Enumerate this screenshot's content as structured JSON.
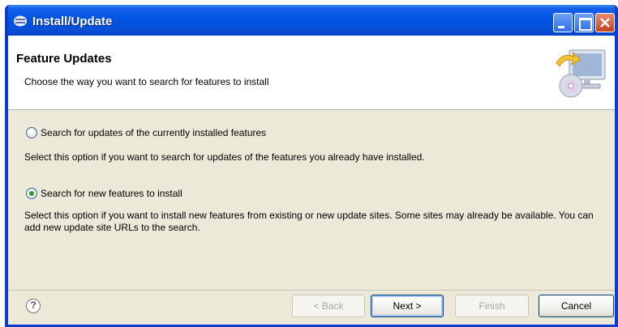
{
  "window": {
    "title": "Install/Update"
  },
  "banner": {
    "title": "Feature Updates",
    "description": "Choose the way you want to search for features to install"
  },
  "options": [
    {
      "label": "Search for updates of the currently installed features",
      "description": "Select this option if you want to search for updates of the features you already have installed.",
      "selected": false
    },
    {
      "label": "Search for new features to install",
      "description": "Select this option if you want to install new features from existing or new update sites. Some sites may already be available. You can add new update site URLs to the search.",
      "selected": true
    }
  ],
  "buttons": {
    "back": "< Back",
    "next": "Next >",
    "finish": "Finish",
    "cancel": "Cancel",
    "help_icon": "?"
  },
  "colors": {
    "titlebar": "#0054e3",
    "window_border": "#0a3ecf",
    "dialog_bg": "#ece9d8",
    "radio_checked": "#2a9a2a"
  },
  "icons": {
    "app": "eclipse-icon",
    "banner": "update-computer-cd-icon",
    "help": "help-icon"
  }
}
